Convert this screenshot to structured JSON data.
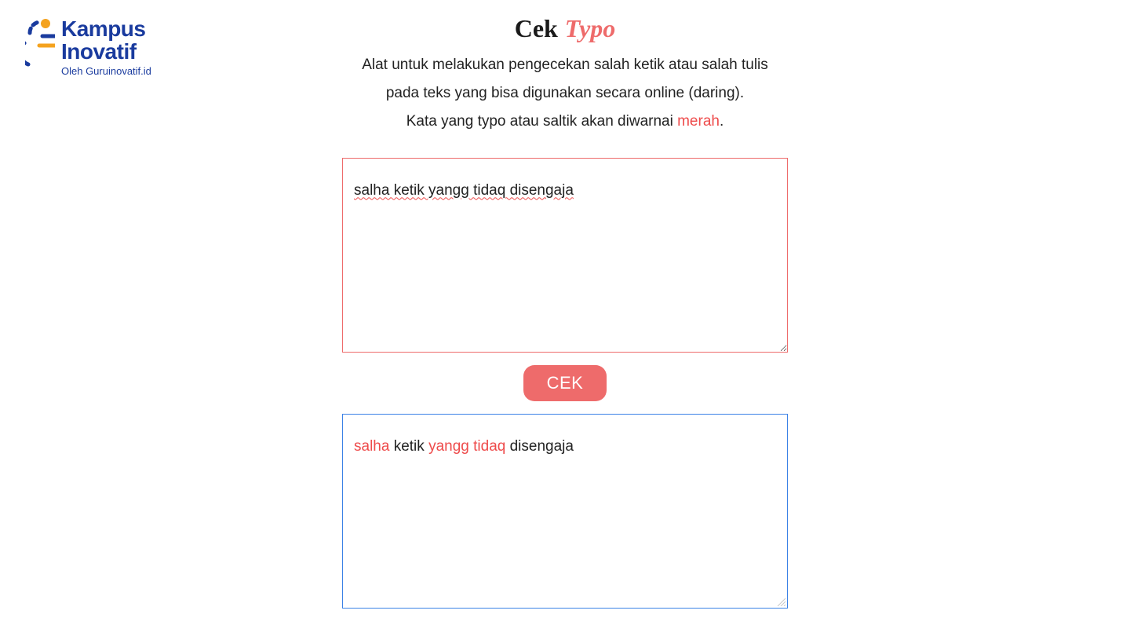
{
  "logo": {
    "line1": "Kampus",
    "line2": "Inovatif",
    "sub": "Oleh Guruinovatif.id"
  },
  "title": {
    "cek": "Cek",
    "typo": "Typo"
  },
  "desc": {
    "line1": "Alat untuk melakukan pengecekan salah ketik atau salah tulis",
    "line2": "pada teks yang bisa digunakan secara online (daring).",
    "line3_a": "Kata yang typo atau saltik akan diwarnai ",
    "line3_red": "merah",
    "line3_b": "."
  },
  "input": {
    "value": "salha ketik yangg tidaq disengaja"
  },
  "button": {
    "cek": "CEK"
  },
  "output": {
    "words": [
      {
        "text": "salha",
        "typo": true
      },
      {
        "text": " ",
        "typo": false
      },
      {
        "text": "ketik",
        "typo": false
      },
      {
        "text": " ",
        "typo": false
      },
      {
        "text": "yangg",
        "typo": true
      },
      {
        "text": " ",
        "typo": false
      },
      {
        "text": "tidaq",
        "typo": true
      },
      {
        "text": " ",
        "typo": false
      },
      {
        "text": "disengaja",
        "typo": false
      }
    ]
  },
  "colors": {
    "brand_blue": "#1a3b9e",
    "brand_orange": "#f4a21e",
    "red": "#ee4b4b",
    "salmon": "#ee6b6b",
    "output_border": "#3b82e6"
  }
}
